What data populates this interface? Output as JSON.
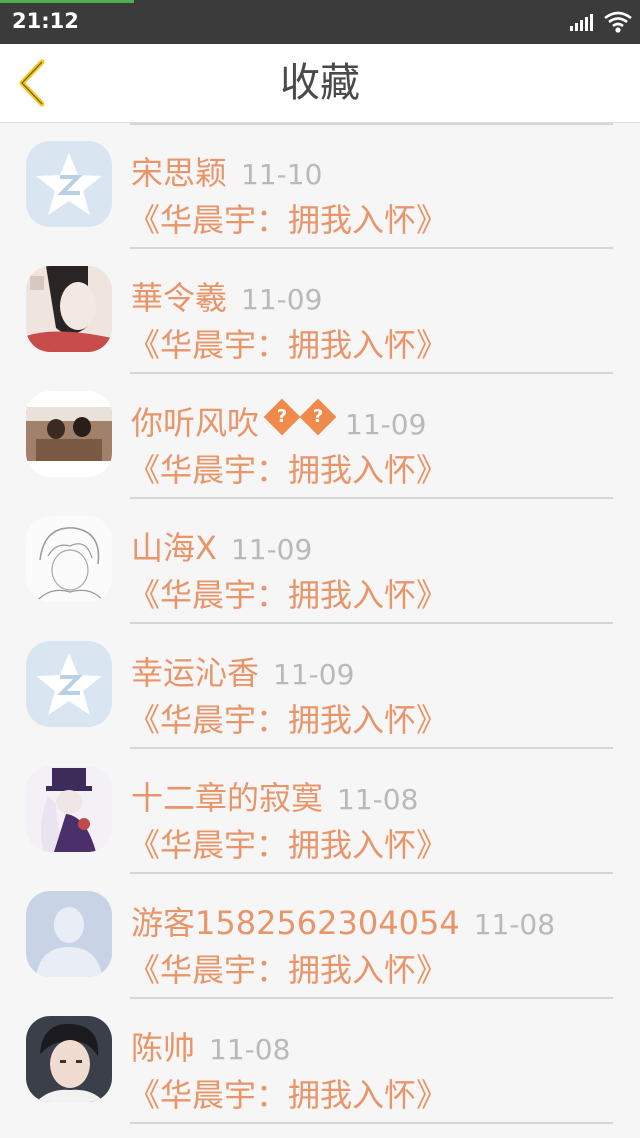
{
  "status_bar": {
    "time": "21:12"
  },
  "header": {
    "title": "收藏",
    "back_icon": "chevron-left-icon"
  },
  "colors": {
    "accent": "#e8956a",
    "date": "#b9b9b9",
    "back": "#f5c518"
  },
  "favorites": [
    {
      "name": "宋思颖",
      "badge": "",
      "date": "11-10",
      "title": "《华晨宇：拥我入怀》",
      "avatar": "qq-default-avatar"
    },
    {
      "name": "華令羲",
      "badge": "",
      "date": "11-09",
      "title": "《华晨宇：拥我入怀》",
      "avatar": "user-photo-avatar"
    },
    {
      "name": "你听风吹",
      "badge": "??",
      "date": "11-09",
      "title": "《华晨宇：拥我入怀》",
      "avatar": "user-photo-avatar"
    },
    {
      "name": "山海X",
      "badge": "",
      "date": "11-09",
      "title": "《华晨宇：拥我入怀》",
      "avatar": "sketch-avatar"
    },
    {
      "name": "幸运沁香",
      "badge": "",
      "date": "11-09",
      "title": "《华晨宇：拥我入怀》",
      "avatar": "qq-default-avatar"
    },
    {
      "name": "十二章的寂寞",
      "badge": "",
      "date": "11-08",
      "title": "《华晨宇：拥我入怀》",
      "avatar": "user-photo-avatar"
    },
    {
      "name": "游客1582562304054",
      "badge": "",
      "date": "11-08",
      "title": "《华晨宇：拥我入怀》",
      "avatar": "guest-silhouette-avatar"
    },
    {
      "name": "陈帅",
      "badge": "",
      "date": "11-08",
      "title": "《华晨宇：拥我入怀》",
      "avatar": "user-photo-avatar"
    }
  ]
}
